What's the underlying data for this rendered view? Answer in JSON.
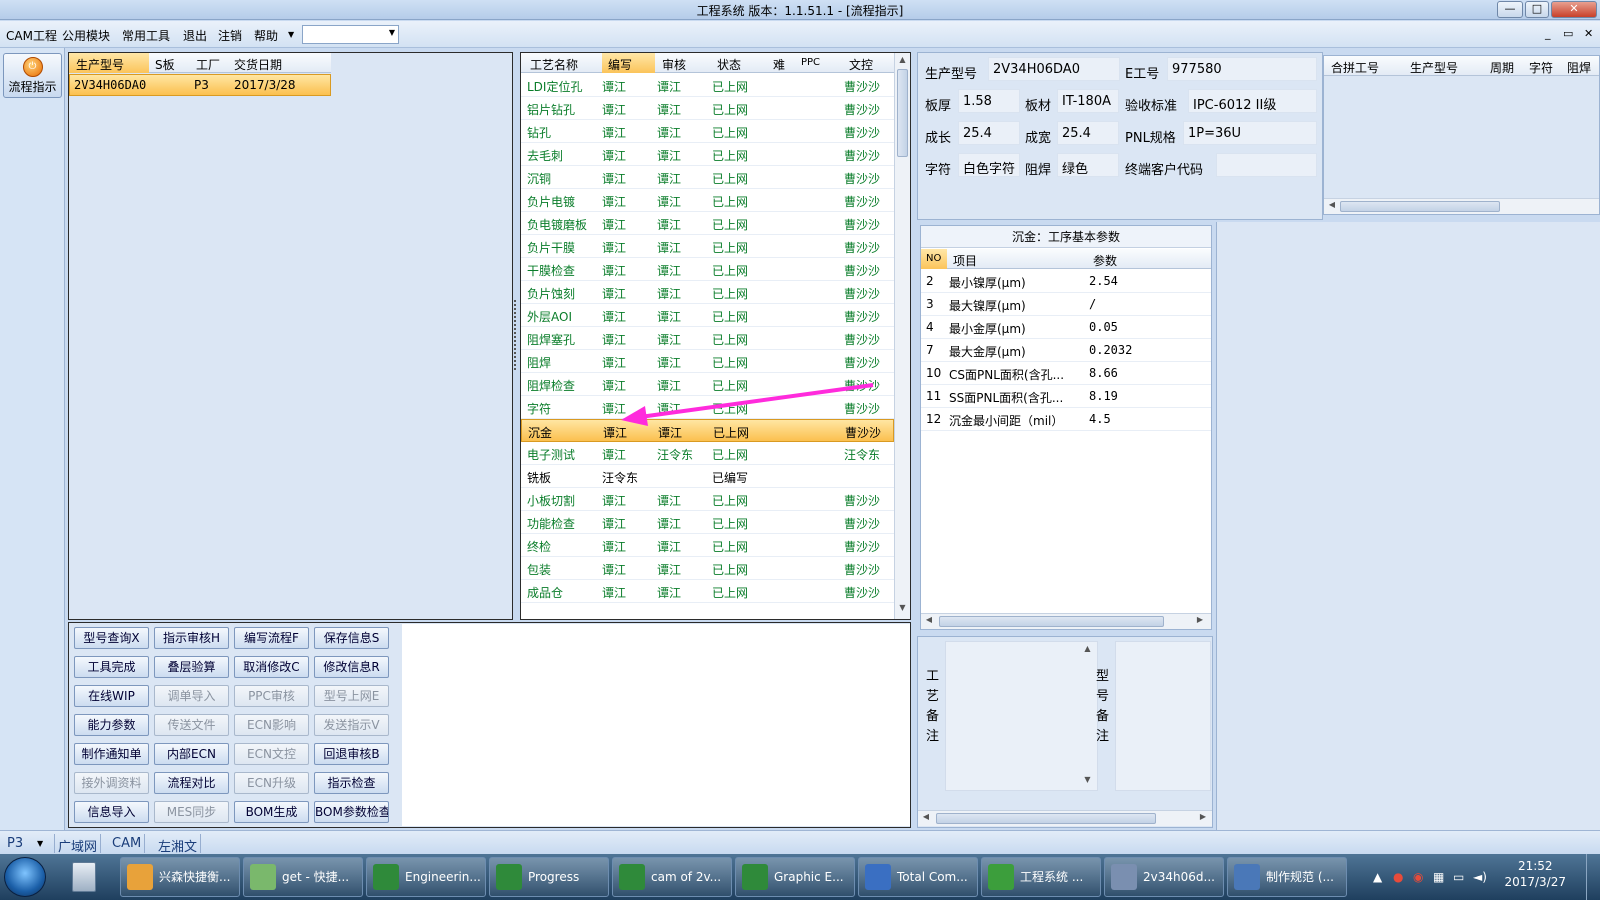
{
  "window": {
    "title": "工程系统   版本：1.1.51.1 - [流程指示]",
    "controls": [
      "—",
      "□",
      "✕"
    ]
  },
  "menu": {
    "items": [
      "CAM工程",
      "公用模块",
      "常用工具",
      "退出",
      "注销",
      "帮助"
    ],
    "combo_value": "",
    "mdi_controls": [
      "_",
      "▭",
      "✕"
    ]
  },
  "leftbar": {
    "flow_button": "流程指示"
  },
  "order_list": {
    "headers": [
      "生产型号",
      "S板",
      "工厂",
      "交货日期"
    ],
    "rows": [
      [
        "2V34H06DA0",
        "",
        "P3",
        "2017/3/28"
      ]
    ]
  },
  "process": {
    "headers": [
      "工艺名称",
      "编写",
      "审核",
      "状态",
      "难",
      "PPC",
      "文控"
    ],
    "rows": [
      [
        "LDI定位孔",
        "谭江",
        "谭江",
        "已上网",
        "",
        "",
        "曹沙沙"
      ],
      [
        "铝片钻孔",
        "谭江",
        "谭江",
        "已上网",
        "",
        "",
        "曹沙沙"
      ],
      [
        "钻孔",
        "谭江",
        "谭江",
        "已上网",
        "",
        "",
        "曹沙沙"
      ],
      [
        "去毛刺",
        "谭江",
        "谭江",
        "已上网",
        "",
        "",
        "曹沙沙"
      ],
      [
        "沉铜",
        "谭江",
        "谭江",
        "已上网",
        "",
        "",
        "曹沙沙"
      ],
      [
        "负片电镀",
        "谭江",
        "谭江",
        "已上网",
        "",
        "",
        "曹沙沙"
      ],
      [
        "负电镀磨板",
        "谭江",
        "谭江",
        "已上网",
        "",
        "",
        "曹沙沙"
      ],
      [
        "负片干膜",
        "谭江",
        "谭江",
        "已上网",
        "",
        "",
        "曹沙沙"
      ],
      [
        "干膜检查",
        "谭江",
        "谭江",
        "已上网",
        "",
        "",
        "曹沙沙"
      ],
      [
        "负片蚀刻",
        "谭江",
        "谭江",
        "已上网",
        "",
        "",
        "曹沙沙"
      ],
      [
        "外层AOI",
        "谭江",
        "谭江",
        "已上网",
        "",
        "",
        "曹沙沙"
      ],
      [
        "阻焊塞孔",
        "谭江",
        "谭江",
        "已上网",
        "",
        "",
        "曹沙沙"
      ],
      [
        "阻焊",
        "谭江",
        "谭江",
        "已上网",
        "",
        "",
        "曹沙沙"
      ],
      [
        "阻焊检查",
        "谭江",
        "谭江",
        "已上网",
        "",
        "",
        "曹沙沙"
      ],
      [
        "字符",
        "谭江",
        "谭江",
        "已上网",
        "",
        "",
        "曹沙沙"
      ],
      [
        "沉金",
        "谭江",
        "谭江",
        "已上网",
        "",
        "",
        "曹沙沙"
      ],
      [
        "电子测试",
        "谭江",
        "汪令东",
        "已上网",
        "",
        "",
        "汪令东"
      ],
      [
        "铣板",
        "汪令东",
        "",
        "已编写",
        "",
        "",
        ""
      ],
      [
        "小板切割",
        "谭江",
        "谭江",
        "已上网",
        "",
        "",
        "曹沙沙"
      ],
      [
        "功能检查",
        "谭江",
        "谭江",
        "已上网",
        "",
        "",
        "曹沙沙"
      ],
      [
        "终检",
        "谭江",
        "谭江",
        "已上网",
        "",
        "",
        "曹沙沙"
      ],
      [
        "包装",
        "谭江",
        "谭江",
        "已上网",
        "",
        "",
        "曹沙沙"
      ],
      [
        "成品仓",
        "谭江",
        "谭江",
        "已上网",
        "",
        "",
        "曹沙沙"
      ]
    ],
    "selected_index": 15,
    "uncolored_index": 17
  },
  "buttons": [
    [
      "型号查询X",
      "指示审核H",
      "编写流程F",
      "保存信息S"
    ],
    [
      "工具完成",
      "叠层验算",
      "取消修改C",
      "修改信息R"
    ],
    [
      "在线WIP",
      "调单导入",
      "PPC审核",
      "型号上网E"
    ],
    [
      "能力参数",
      "传送文件",
      "ECN影响",
      "发送指示V"
    ],
    [
      "制作通知单",
      "内部ECN",
      "ECN文控",
      "回退审核B"
    ],
    [
      "接外调资料",
      "流程对比",
      "ECN升级",
      "指示检查"
    ],
    [
      "信息导入",
      "MES同步",
      "BOM生成",
      "BOM参数检查"
    ]
  ],
  "disabled_buttons": [
    "调单导入",
    "PPC审核",
    "型号上网E",
    "传送文件",
    "ECN影响",
    "发送指示V",
    "ECN文控",
    "接外调资料",
    "ECN升级",
    "MES同步"
  ],
  "info": {
    "model_label": "生产型号",
    "model_value": "2V34H06DA0",
    "eno_label": "E工号",
    "eno_value": "977580",
    "thick_label": "板厚",
    "thick_value": "1.58",
    "mat_label": "板材",
    "mat_value": "IT-180A",
    "std_label": "验收标准",
    "std_value": "IPC-6012 II级",
    "len_label": "成长",
    "len_value": "25.4",
    "wid_label": "成宽",
    "wid_value": "25.4",
    "pnl_label": "PNL规格",
    "pnl_value": "1P=36U",
    "char_label": "字符",
    "char_value": "白色字符",
    "mask_label": "阻焊",
    "mask_value": "绿色",
    "cust_label": "终端客户代码",
    "cust_value": ""
  },
  "merge": {
    "headers": [
      "合拼工号",
      "生产型号",
      "周期",
      "字符",
      "阻焊"
    ]
  },
  "params": {
    "title": "沉金：工序基本参数",
    "headers": [
      "NO",
      "项目",
      "参数"
    ],
    "rows": [
      [
        "2",
        "最小镍厚(μm)",
        "2.54"
      ],
      [
        "3",
        "最大镍厚(μm)",
        "/"
      ],
      [
        "4",
        "最小金厚(μm)",
        "0.05"
      ],
      [
        "7",
        "最大金厚(μm)",
        "0.2032"
      ],
      [
        "10",
        "CS面PNL面积(含孔...",
        "8.66"
      ],
      [
        "11",
        "SS面PNL面积(含孔...",
        "8.19"
      ],
      [
        "12",
        "沉金最小间距（mil）",
        "4.5"
      ]
    ]
  },
  "notes": {
    "process_note_label": "工艺备注",
    "model_note_label": "型号备注"
  },
  "status": {
    "factory": "P3",
    "tabs": [
      "广域网",
      "CAM",
      "左湘文"
    ]
  },
  "taskbar": {
    "items": [
      "兴森快捷衡...",
      "get - 快捷...",
      "Engineerin...",
      "Progress",
      "cam of 2v...",
      "Graphic E...",
      "Total Com...",
      "工程系统 ...",
      "2v34h06d...",
      "制作规范 (..."
    ],
    "time": "21:52",
    "date": "2017/3/27"
  },
  "colors": {
    "accent_selection": "#fbc04f",
    "green_text": "#0a7d2a",
    "arrow": "#ff2bdc"
  }
}
